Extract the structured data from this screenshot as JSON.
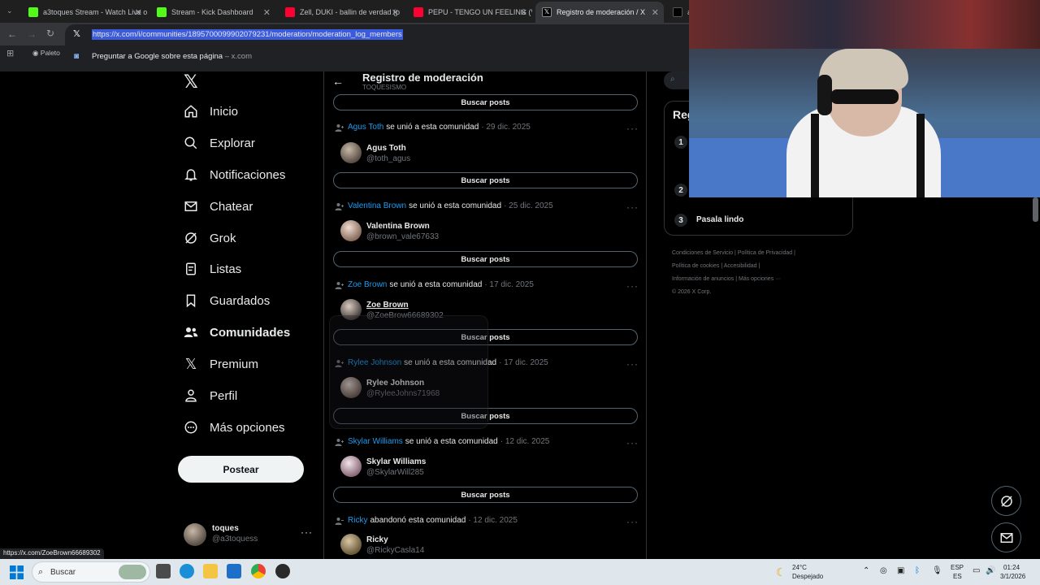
{
  "browser": {
    "tabs": [
      {
        "label": "a3toques Stream - Watch Live o",
        "fav_color": "#53fc18"
      },
      {
        "label": "Stream - Kick Dashboard",
        "fav_color": "#53fc18"
      },
      {
        "label": "Zell, DUKI - ballin de verdad (p",
        "fav_color": "#ff0033"
      },
      {
        "label": "PEPU - TENGO UN FEELING (Vi",
        "fav_color": "#ff0033"
      },
      {
        "label": "Registro de moderación / X",
        "fav_color": "#000000"
      },
      {
        "label": "a",
        "fav_color": "#000000"
      }
    ],
    "url": "https://x.com/i/communities/1895700099902079231/moderation/moderation_log_members",
    "suggestion": "Preguntar a Google sobre esta página",
    "suggestion_domain": "x.com",
    "bookmark_label": "Paleto",
    "status_url": "https://x.com/ZoeBrown66689302"
  },
  "sidebar": {
    "items": [
      {
        "label": "Inicio",
        "icon": "home-icon"
      },
      {
        "label": "Explorar",
        "icon": "search-icon"
      },
      {
        "label": "Notificaciones",
        "icon": "bell-icon"
      },
      {
        "label": "Chatear",
        "icon": "mail-icon"
      },
      {
        "label": "Grok",
        "icon": "grok-icon"
      },
      {
        "label": "Listas",
        "icon": "list-icon"
      },
      {
        "label": "Guardados",
        "icon": "bookmark-icon"
      },
      {
        "label": "Comunidades",
        "icon": "communities-icon"
      },
      {
        "label": "Premium",
        "icon": "x-icon"
      },
      {
        "label": "Perfil",
        "icon": "person-icon"
      },
      {
        "label": "Más opciones",
        "icon": "more-circle-icon"
      }
    ],
    "post_button": "Postear",
    "account_name": "toques",
    "account_handle": "@a3toquess"
  },
  "main": {
    "title": "Registro de moderación",
    "subtitle": "TOQUESISMO",
    "buscar_label": "Buscar posts",
    "entries": [
      {
        "user": "Agus Toth",
        "action": "se unió a esta comunidad",
        "date": "· 29 dic. 2025",
        "name": "Agus Toth",
        "handle": "@toth_agus"
      },
      {
        "user": "Valentina Brown",
        "action": "se unió a esta comunidad",
        "date": "· 25 dic. 2025",
        "name": "Valentina Brown",
        "handle": "@brown_vale67633"
      },
      {
        "user": "Zoe Brown",
        "action": "se unió a esta comunidad",
        "date": "· 17 dic. 2025",
        "name": "Zoe Brown",
        "handle": "@ZoeBrow66689302"
      },
      {
        "user": "Rylee Johnson",
        "action": "se unió a esta comunidad",
        "date": "· 17 dic. 2025",
        "name": "Rylee Johnson",
        "handle": "@RyleeJohns71968"
      },
      {
        "user": "Skylar Williams",
        "action": "se unió a esta comunidad",
        "date": "· 12 dic. 2025",
        "name": "Skylar Williams",
        "handle": "@SkylarWill285"
      },
      {
        "user": "Ricky",
        "action": "abandonó esta comunidad",
        "date": "· 12 dic. 2025",
        "name": "Ricky",
        "handle": "@RickyCasla14"
      }
    ]
  },
  "right": {
    "trend_title": "Reg",
    "trend_numbers": [
      "1",
      "2",
      "3"
    ],
    "trend_3_name": "Pasala lindo",
    "footer": [
      "Condiciones de Servicio",
      "Política de Privacidad",
      "Política de cookies",
      "Accesibilidad",
      "Información de anuncios",
      "Más opciones ···",
      "© 2026 X Corp."
    ]
  },
  "taskbar": {
    "search_placeholder": "Buscar",
    "weather_temp": "24°C",
    "weather_desc": "Despejado",
    "lang_top": "ESP",
    "lang_bottom": "ES",
    "time": "01:24",
    "date": "3/1/2026"
  }
}
